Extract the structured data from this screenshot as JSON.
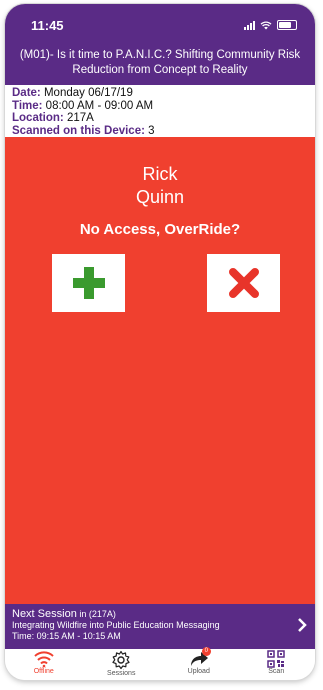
{
  "status_bar": {
    "time": "11:45"
  },
  "session": {
    "title_line1": "(M01)- Is it time to P.A.N.I.C.? Shifting Community Risk",
    "title_line2": "Reduction from Concept to Reality"
  },
  "details": {
    "date_label": "Date:",
    "date_value": "Monday 06/17/19",
    "time_label": "Time:",
    "time_value": "08:00 AM - 09:00 AM",
    "location_label": "Location:",
    "location_value": "217A",
    "scanned_label": "Scanned on this Device:",
    "scanned_value": "3"
  },
  "attendee": {
    "first_name": "Rick",
    "last_name": "Quinn"
  },
  "prompt": "No Access, OverRide?",
  "buttons": {
    "accept_icon": "plus-icon",
    "reject_icon": "close-icon"
  },
  "next_session": {
    "label": "Next Session",
    "location": "in (217A)",
    "title": "Integrating Wildfire into Public Education Messaging",
    "time": "Time: 09:15 AM - 10:15 AM"
  },
  "tabs": [
    {
      "label": "Offline",
      "icon": "wifi-icon"
    },
    {
      "label": "Sessions",
      "icon": "gear-icon"
    },
    {
      "label": "Upload",
      "icon": "upload-icon",
      "badge": "0"
    },
    {
      "label": "Scan",
      "icon": "qr-code-icon"
    }
  ],
  "colors": {
    "purple": "#5a2b86",
    "red": "#f0402f",
    "green": "#3a9a2e",
    "accent_red": "#e8342a"
  }
}
